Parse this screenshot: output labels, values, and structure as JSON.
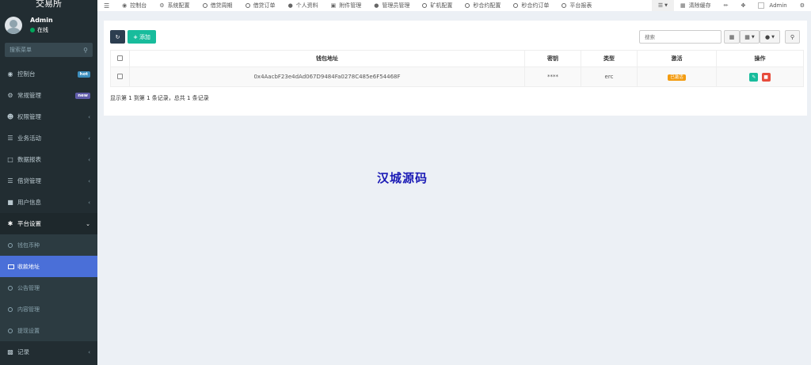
{
  "brand": "交易所",
  "user": {
    "name": "Admin",
    "status": "在线"
  },
  "sidebar": {
    "search_placeholder": "搜索菜单",
    "items": [
      {
        "label": "控制台",
        "icon": "dashboard-icon",
        "badge": "hot"
      },
      {
        "label": "常规管理",
        "icon": "cogs-icon",
        "badge": "new"
      },
      {
        "label": "权限管理",
        "icon": "group-icon"
      },
      {
        "label": "业务活动",
        "icon": "list-icon"
      },
      {
        "label": "数据报表",
        "icon": "file-icon"
      },
      {
        "label": "借贷管理",
        "icon": "list-icon"
      },
      {
        "label": "用户信息",
        "icon": "user-icon"
      },
      {
        "label": "平台设置",
        "icon": "gear-icon"
      }
    ],
    "sub_items": [
      {
        "label": "钱包币种"
      },
      {
        "label": "收款地址"
      },
      {
        "label": "公告管理"
      },
      {
        "label": "内容管理"
      },
      {
        "label": "提现设置"
      }
    ],
    "last_item": {
      "label": "记录",
      "icon": "chart-icon"
    }
  },
  "topbar": {
    "tabs": [
      "控制台",
      "系统配置",
      "借贷周期",
      "借贷订单",
      "个人资料",
      "附件管理",
      "管理员管理",
      "矿机配置",
      "秒合约配置",
      "秒合约订单",
      "平台报表"
    ],
    "clear_cache": "清除缓存",
    "admin": "Admin"
  },
  "toolbar": {
    "add_label": "添加",
    "search_placeholder": "搜索"
  },
  "table": {
    "headers": [
      "钱包地址",
      "密钥",
      "类型",
      "激活",
      "操作"
    ],
    "rows": [
      {
        "address": "0x4AacbF23e4dAd067D9484Fa0278C485e6F54468F",
        "key": "****",
        "type": "erc",
        "active": "已激活"
      }
    ]
  },
  "pager_info": "显示第 1 到第 1 条记录，总共 1 条记录",
  "watermark": "汉城源码",
  "colors": {
    "sidebar": "#222d32",
    "active": "#4a6fd8",
    "accent": "#18bc9c",
    "danger": "#e74c3c",
    "warning": "#f39c12"
  }
}
